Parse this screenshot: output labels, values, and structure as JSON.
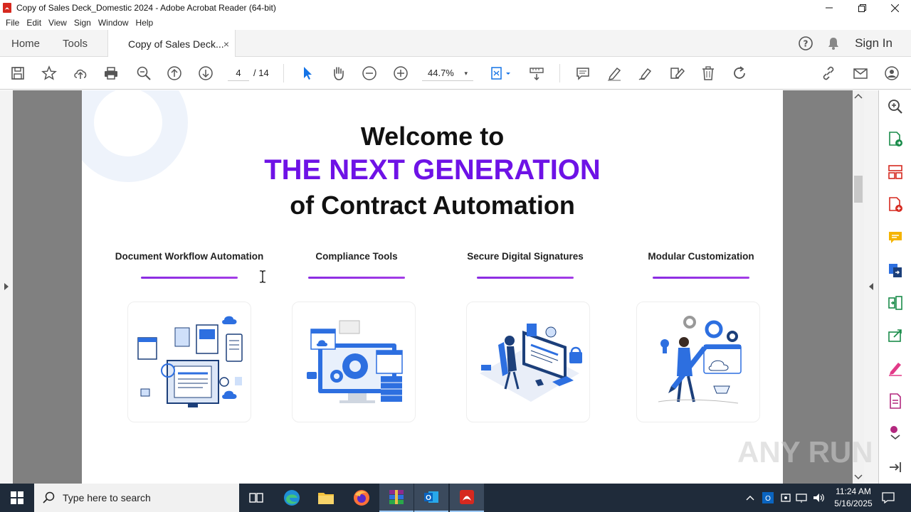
{
  "window": {
    "title": "Copy of Sales Deck_Domestic 2024 - Adobe Acrobat Reader (64-bit)",
    "icons": [
      "acrobat-app-icon",
      "minimize-icon",
      "maximize-icon",
      "close-icon"
    ]
  },
  "menu": [
    "File",
    "Edit",
    "View",
    "Sign",
    "Window",
    "Help"
  ],
  "tabs": {
    "home": "Home",
    "tools": "Tools",
    "document": "Copy of Sales Deck...",
    "close": "×",
    "sign_in": "Sign In"
  },
  "toolbar": {
    "page_current": "4",
    "page_total": "/  14",
    "zoom": "44.7%",
    "zoom_caret": "▾"
  },
  "page": {
    "line1": "Welcome to",
    "line2": "THE NEXT GENERATION",
    "line3": "of Contract Automation",
    "accent_color": "#6e12e6",
    "features": [
      {
        "label": "Document Workflow Automation"
      },
      {
        "label": "Compliance Tools"
      },
      {
        "label": "Secure Digital Signatures"
      },
      {
        "label": "Modular Customization"
      }
    ]
  },
  "watermark": "ANY RUN",
  "taskbar": {
    "search_placeholder": "Type here to search",
    "time": "11:24 AM",
    "date": "5/16/2025",
    "apps": [
      "task-view-icon",
      "edge-icon",
      "file-explorer-icon",
      "firefox-icon",
      "winrar-icon",
      "outlook-icon",
      "acrobat-icon"
    ]
  }
}
